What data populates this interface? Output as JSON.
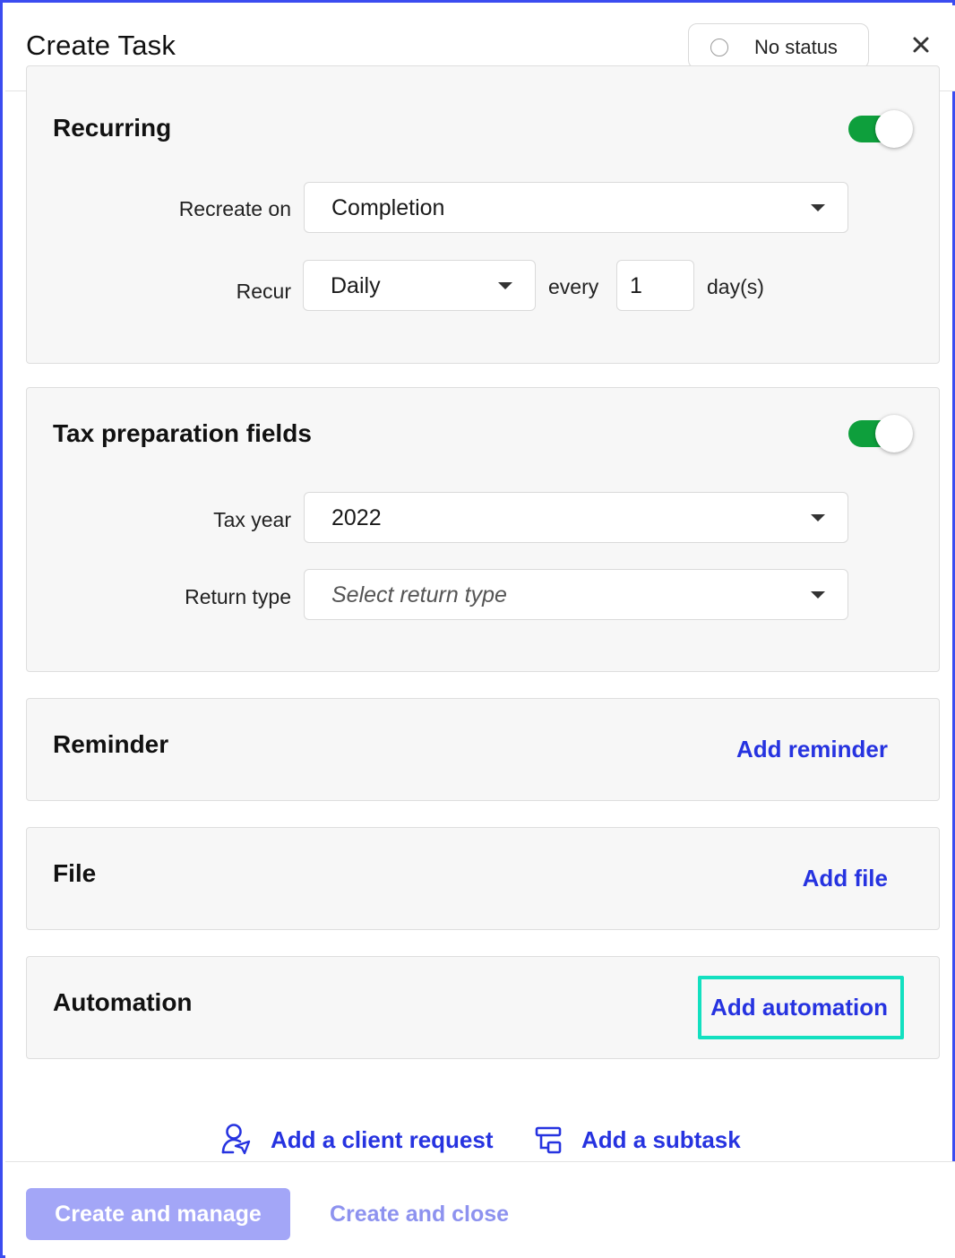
{
  "header": {
    "title": "Create Task",
    "status_label": "No status"
  },
  "recurring": {
    "title": "Recurring",
    "enabled": true,
    "recreate_on_label": "Recreate on",
    "recreate_on_value": "Completion",
    "recur_label": "Recur",
    "recur_value": "Daily",
    "every_label": "every",
    "interval_value": "1",
    "unit_label": "day(s)"
  },
  "tax": {
    "title": "Tax preparation fields",
    "enabled": true,
    "tax_year_label": "Tax year",
    "tax_year_value": "2022",
    "return_type_label": "Return type",
    "return_type_placeholder": "Select return type"
  },
  "reminder": {
    "title": "Reminder",
    "action": "Add reminder"
  },
  "file": {
    "title": "File",
    "action": "Add file"
  },
  "automation": {
    "title": "Automation",
    "action": "Add automation"
  },
  "bottom_links": {
    "client_request": "Add a client request",
    "subtask": "Add a subtask"
  },
  "footer": {
    "create_manage": "Create and manage",
    "create_close": "Create and close"
  },
  "colors": {
    "accent": "#2633e0",
    "toggle_on": "#0e9f3c",
    "focus_ring": "#13e0c0",
    "primary_disabled": "#a3a6f7"
  },
  "icons": {
    "close": "close-icon",
    "client_request": "user-send-icon",
    "subtask": "subtask-icon",
    "dropdown": "chevron-down-icon"
  }
}
